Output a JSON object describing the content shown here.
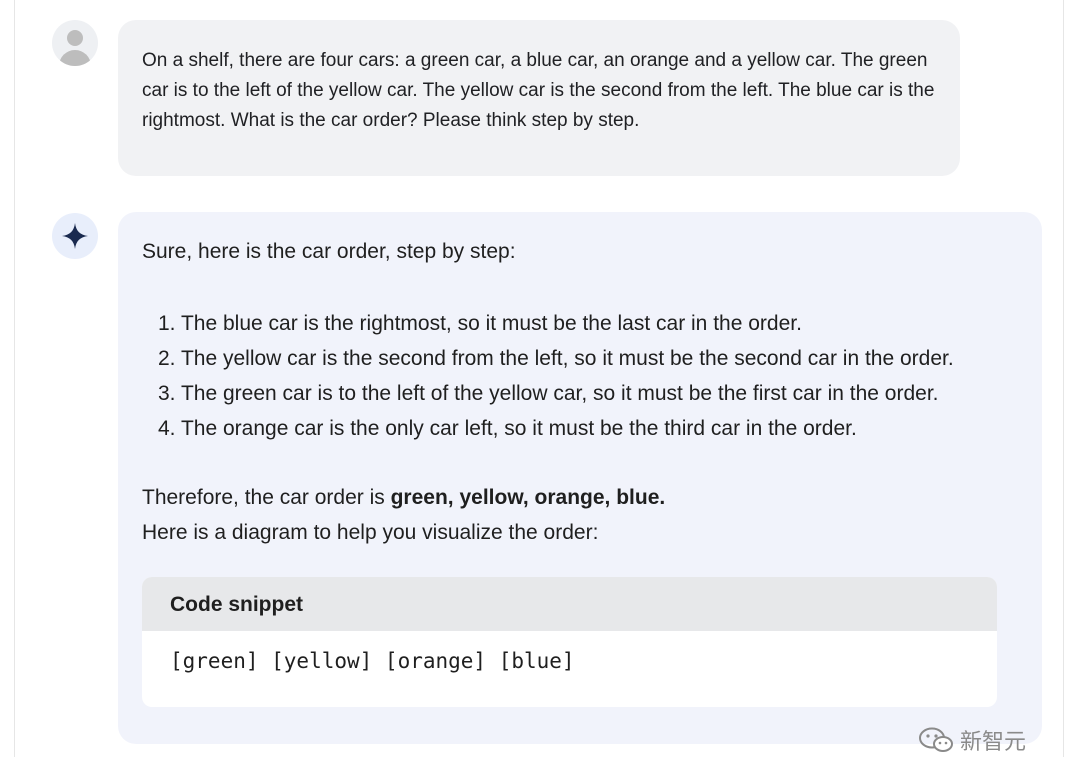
{
  "user": {
    "message": "On a shelf, there are four cars: a green car, a blue car, an orange and a yellow car. The green car is to the left of the yellow car. The yellow car is the second from the left. The blue car is the rightmost. What is the car order? Please think step by step."
  },
  "assistant": {
    "intro": "Sure, here is the car order, step by step:",
    "steps": [
      "1. The blue car is the rightmost, so it must be the last car in the order.",
      "2. The yellow car is the second from the left, so it must be the second car in the order.",
      "3. The green car is to the left of the yellow car, so it must be the first car in the order.",
      "4. The orange car is the only car left, so it must be the third car in the order."
    ],
    "conclusion_prefix": "Therefore, the car order is ",
    "conclusion_bold": "green, yellow, orange, blue.",
    "diagram_intro": "Here is a diagram to help you visualize the order:",
    "code_block": {
      "title": "Code snippet",
      "content": "[green] [yellow] [orange] [blue]"
    }
  },
  "watermark": {
    "text": "新智元",
    "icon": "wechat-icon"
  },
  "colors": {
    "user_bubble": "#f1f2f4",
    "assistant_bubble": "#f1f3fb",
    "code_header": "#e7e8ea",
    "sparkle": "#1a2a4f"
  }
}
